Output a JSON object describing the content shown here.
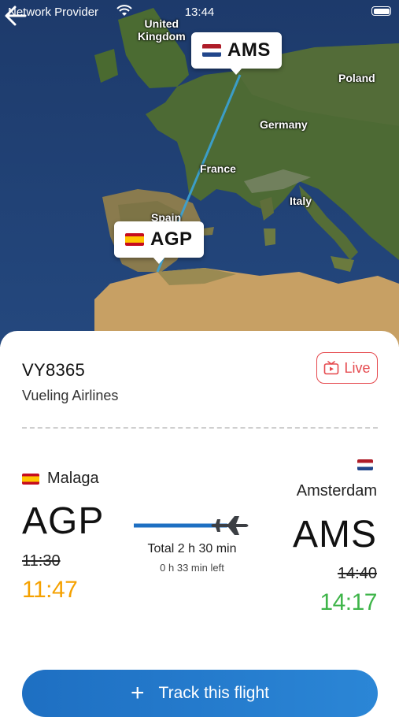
{
  "status_bar": {
    "carrier": "Network Provider",
    "time": "13:44"
  },
  "map": {
    "labels": {
      "uk": "United\nKingdom",
      "poland": "Poland",
      "germany": "Germany",
      "france": "France",
      "italy": "Italy",
      "spain": "Spain"
    },
    "origin_pin": {
      "code": "AGP",
      "flag": "flag-es-icon"
    },
    "destination_pin": {
      "code": "AMS",
      "flag": "flag-nl-icon"
    },
    "route_color": "#3aa3d8"
  },
  "flight": {
    "number": "VY8365",
    "airline": "Vueling Airlines",
    "live_label": "Live",
    "origin": {
      "city": "Malaga",
      "code": "AGP",
      "scheduled": "11:30",
      "actual": "11:47"
    },
    "destination": {
      "city": "Amsterdam",
      "code": "AMS",
      "scheduled": "14:40",
      "actual": "14:17"
    },
    "total_duration": "Total 2 h 30 min",
    "time_left": "0 h 33 min left",
    "colors": {
      "delayed": "#f5a100",
      "early": "#3fb54a",
      "live": "#e5484d",
      "accent": "#1e6fc2"
    }
  },
  "actions": {
    "track_label": "Track this flight"
  }
}
